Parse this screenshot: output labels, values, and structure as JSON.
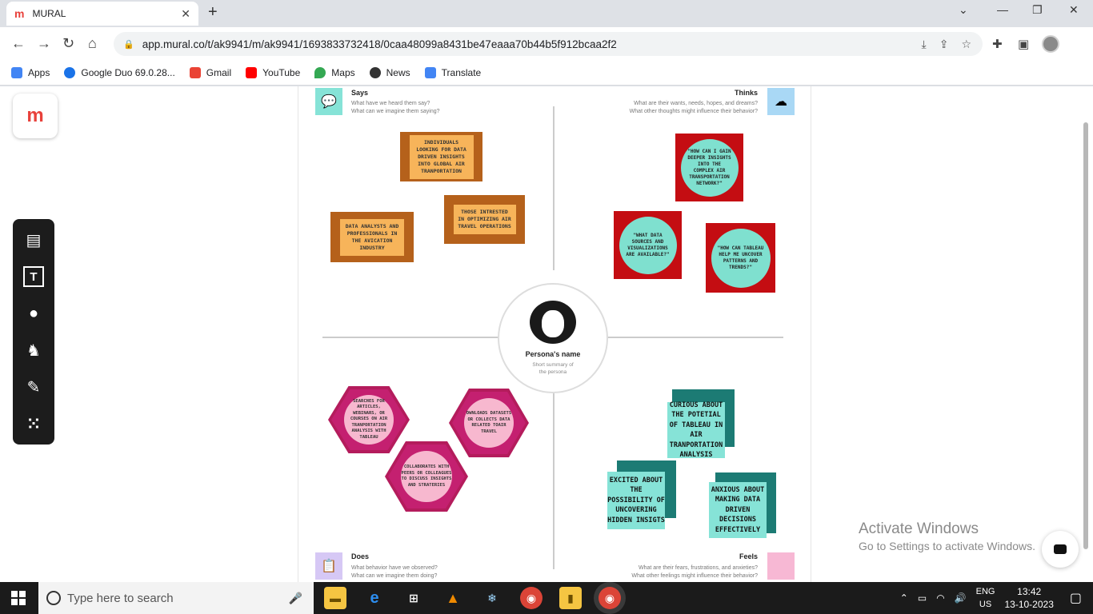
{
  "browser": {
    "tab_title": "MURAL",
    "tab_logo": "m",
    "url": "app.mural.co/t/ak9941/m/ak9941/1693833732418/0caa48099a8431be47eaaa70b44b5f912bcaa2f2",
    "bookmarks": [
      {
        "label": "Apps",
        "color": "#4285f4"
      },
      {
        "label": "Google Duo 69.0.28...",
        "color": "#1a73e8"
      },
      {
        "label": "Gmail",
        "color": "#ea4335"
      },
      {
        "label": "YouTube",
        "color": "#ff0000"
      },
      {
        "label": "Maps",
        "color": "#34a853"
      },
      {
        "label": "News",
        "color": "#333333"
      },
      {
        "label": "Translate",
        "color": "#4285f4"
      }
    ]
  },
  "mural": {
    "logo": "m",
    "tools": [
      "sticky-note",
      "text",
      "shapes",
      "llama",
      "pen",
      "apps-grid"
    ],
    "quadrants": {
      "says": {
        "title": "Says",
        "sub1": "What have we heard them say?",
        "sub2": "What can we imagine them saying?",
        "color": "#86e3d7"
      },
      "thinks": {
        "title": "Thinks",
        "sub1": "What are their wants, needs, hopes, and dreams?",
        "sub2": "What other thoughts might influence their behavior?",
        "color": "#a9d8f5"
      },
      "does": {
        "title": "Does",
        "sub1": "What behavior have we observed?",
        "sub2": "What can we imagine them doing?",
        "color": "#d6c8f5"
      },
      "feels": {
        "title": "Feels",
        "sub1": "What are their fears, frustrations, and anxieties?",
        "sub2": "What other feelings might influence their behavior?",
        "color": "#f7b8d4"
      }
    },
    "persona": {
      "name": "Persona's name",
      "summary": "Short summary of the persona"
    },
    "says_notes": [
      "INDIVIDUALS LOOKING FOR DATA DRIVEN INSIGHTS INTO GLOBAL AIR TRANPORTATION",
      "THOSE INTRESTED IN OPTIMIZING AIR TRAVEL OPERATIONS",
      "DATA ANALYSTS AND PROFESSIONALS IN THE AVICATION INDUSTRY"
    ],
    "thinks_notes": [
      "\"HOW CAN I GAIN DEEPER INSIGHTS INTO THE COMPLEX AIR TRANSPORTATION NETWORK?\"",
      "\"WHAT DATA SOURCES AND VISUALIZATIONS ARE AVAILABLE?\"",
      "\"HOW CAN TABLEAU HELP ME UNCOVER PATTERNS AND TRENDS?\""
    ],
    "does_notes": [
      "SEARCHES FOR ARTICLES, WEBINARS, OR COURSES ON AIR TRANPORTATION ANALYSIS WITH TABLEAU",
      "DWNLOADS DATASETS OR COLLECTS DATA RELATED TOAIR TRAVEL",
      "COLLABORATES WITH PEERS OR COLLEAGUES TO DISCUSS INSIGHTS AND STRATERIES"
    ],
    "feels_notes": [
      "CURIOUS ABOUT THE POTETIAL OF TABLEAU IN AIR TRANPORTATION ANALYSIS",
      "EXCITED ABOUT THE POSSIBILITY OF UNCOVERING HIDDEN INSIGTS",
      "ANXIOUS ABOUT MAKING DATA DRIVEN DECISIONS EFFECTIVELY"
    ]
  },
  "watermark": {
    "line1": "Activate Windows",
    "line2": "Go to Settings to activate Windows."
  },
  "taskbar": {
    "search_placeholder": "Type here to search",
    "lang": "ENG",
    "region": "US",
    "time": "13:42",
    "date": "13-10-2023"
  }
}
